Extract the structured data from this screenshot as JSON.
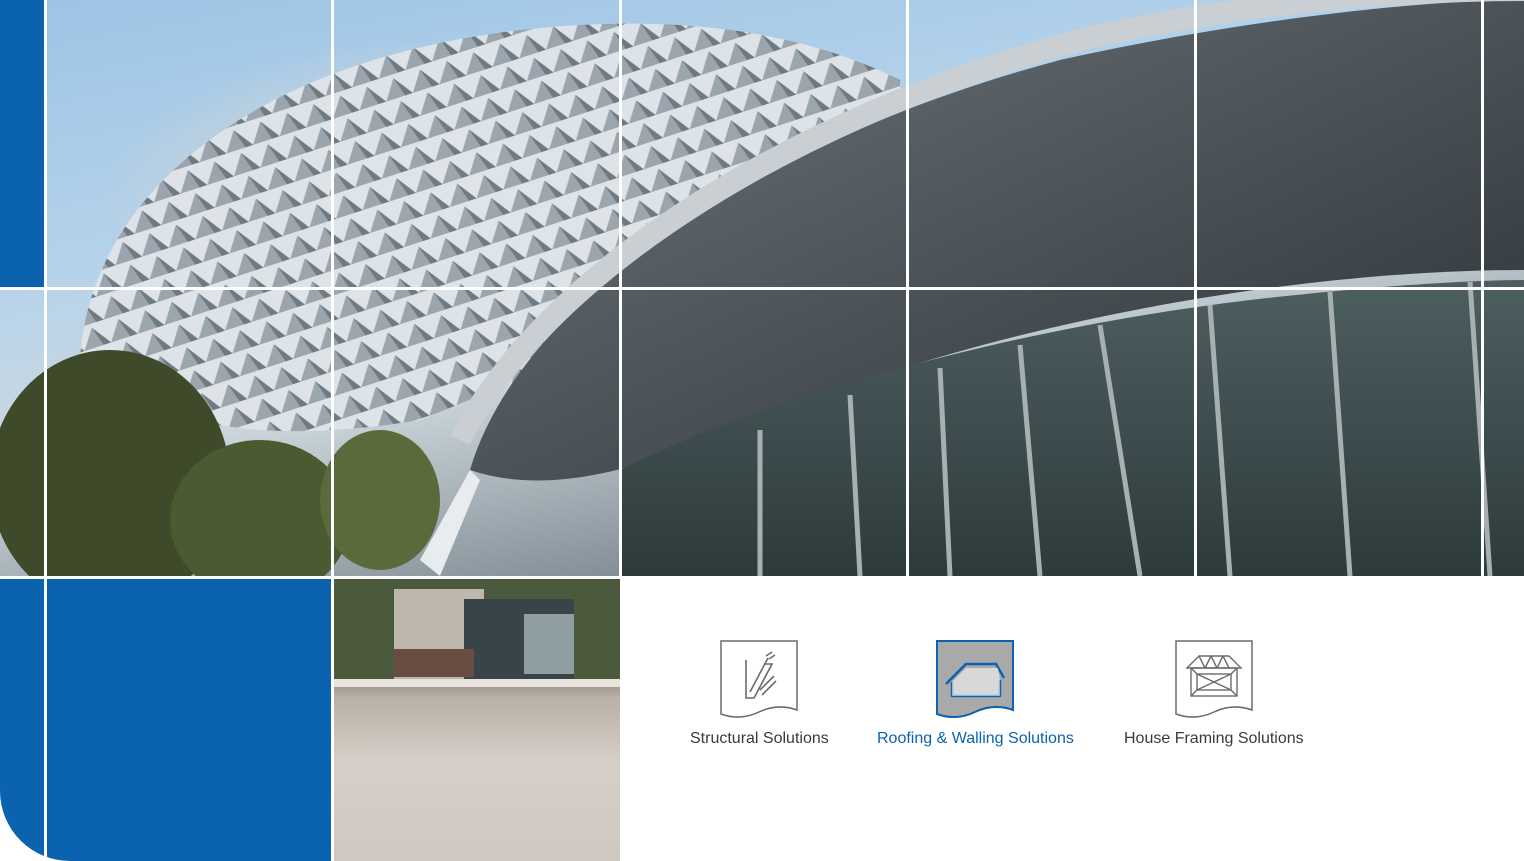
{
  "colors": {
    "brand_blue": "#0b63b0",
    "label_text": "#3a3a3a",
    "active_tile_bg": "#a9a9a9",
    "icon_stroke": "#6b6b6b"
  },
  "solutions": [
    {
      "label": "Structural Solutions",
      "icon": "structural-glass-icon",
      "active": false
    },
    {
      "label": "Roofing & Walling Solutions",
      "icon": "roof-house-icon",
      "active": true
    },
    {
      "label": "House Framing Solutions",
      "icon": "house-frame-truss-icon",
      "active": false
    }
  ]
}
